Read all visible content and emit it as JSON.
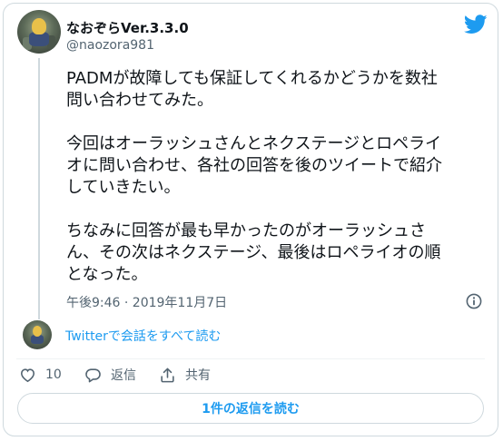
{
  "tweet": {
    "author_name": "なおぞらVer.3.3.0",
    "author_handle": "@naozora981",
    "text": "PADMが故障しても保証してくれるかどうかを数社\n問い合わせてみた。\n\n今回はオーラッシュさんとネクステージとロペライ\nオに問い合わせ、各社の回答を後のツイートで紹介\nしていきたい。\n\nちなみに回答が最も早かったのがオーラッシュさ\nん、その次はネクステージ、最後はロペライオの順\nとなった。",
    "timestamp": "午後9:46 · 2019年11月7日"
  },
  "thread": {
    "link_label": "Twitterで会話をすべて読む"
  },
  "actions": {
    "like_count": "10",
    "reply_label": "返信",
    "share_label": "共有"
  },
  "footer": {
    "read_replies_label": "1件の返信を読む"
  },
  "colors": {
    "accent": "#1d9bf0",
    "secondary_text": "#536471",
    "border": "#cfd9de"
  },
  "icons": [
    "twitter-bird-icon",
    "info-icon",
    "heart-icon",
    "reply-icon",
    "share-icon"
  ]
}
